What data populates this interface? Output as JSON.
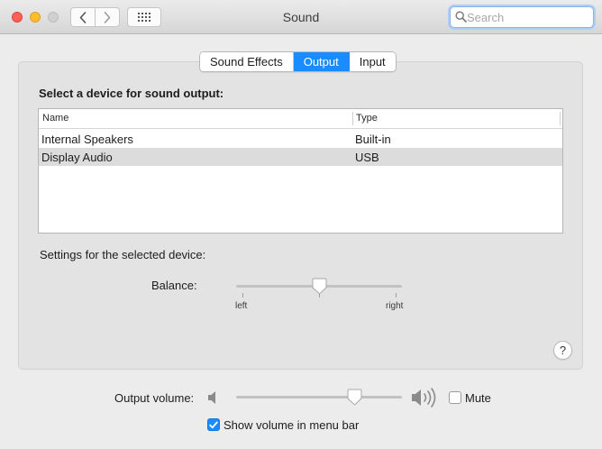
{
  "window": {
    "title": "Sound"
  },
  "toolbar": {
    "back_icon": "chevron-left-icon",
    "forward_icon": "chevron-right-icon",
    "grid_icon": "grid-icon"
  },
  "search": {
    "placeholder": "Search",
    "value": ""
  },
  "tabs": [
    {
      "label": "Sound Effects",
      "active": false
    },
    {
      "label": "Output",
      "active": true
    },
    {
      "label": "Input",
      "active": false
    }
  ],
  "output": {
    "heading": "Select a device for sound output:",
    "columns": {
      "name": "Name",
      "type": "Type"
    },
    "devices": [
      {
        "name": "Internal Speakers",
        "type": "Built-in",
        "selected": false
      },
      {
        "name": "Display Audio",
        "type": "USB",
        "selected": true
      }
    ],
    "settings_label": "Settings for the selected device:",
    "balance": {
      "label": "Balance:",
      "left_label": "left",
      "right_label": "right",
      "value": 0.5
    }
  },
  "help": {
    "label": "?"
  },
  "volume": {
    "label": "Output volume:",
    "value": 0.73,
    "mute_label": "Mute",
    "mute_checked": false,
    "show_in_menu_bar_label": "Show volume in menu bar",
    "show_in_menu_bar_checked": true
  },
  "colors": {
    "accent": "#1a8cff",
    "close": "#fe5f57",
    "minimize": "#febc2e",
    "zoom_disabled": "#d0d0d0"
  }
}
